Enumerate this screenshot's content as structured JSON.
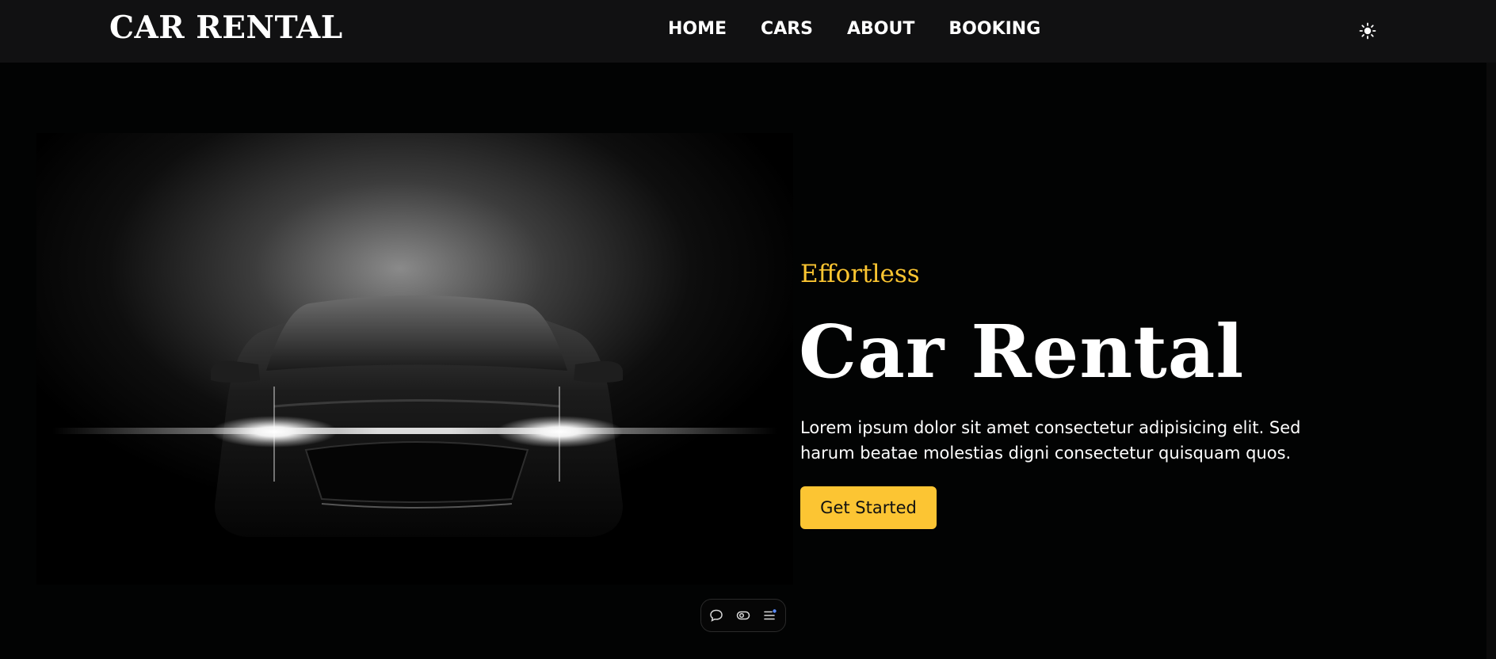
{
  "header": {
    "brand": "CAR RENTAL",
    "nav": [
      "HOME",
      "CARS",
      "ABOUT",
      "BOOKING"
    ],
    "theme_icon": "sun-icon"
  },
  "hero": {
    "subtitle": "Effortless",
    "title": "Car Rental",
    "description": "Lorem ipsum dolor sit amet consectetur adipisicing elit. Sed harum beatae molestias digni consectetur quisquam quos.",
    "cta_label": "Get Started",
    "image_icon": "car-headlights-image"
  },
  "floating_toolbar": {
    "icons": [
      "comment-icon",
      "eye-toggle-icon",
      "list-icon"
    ]
  },
  "colors": {
    "accent": "#fcc533",
    "navbar_bg": "#111112",
    "page_bg": "#020303"
  }
}
